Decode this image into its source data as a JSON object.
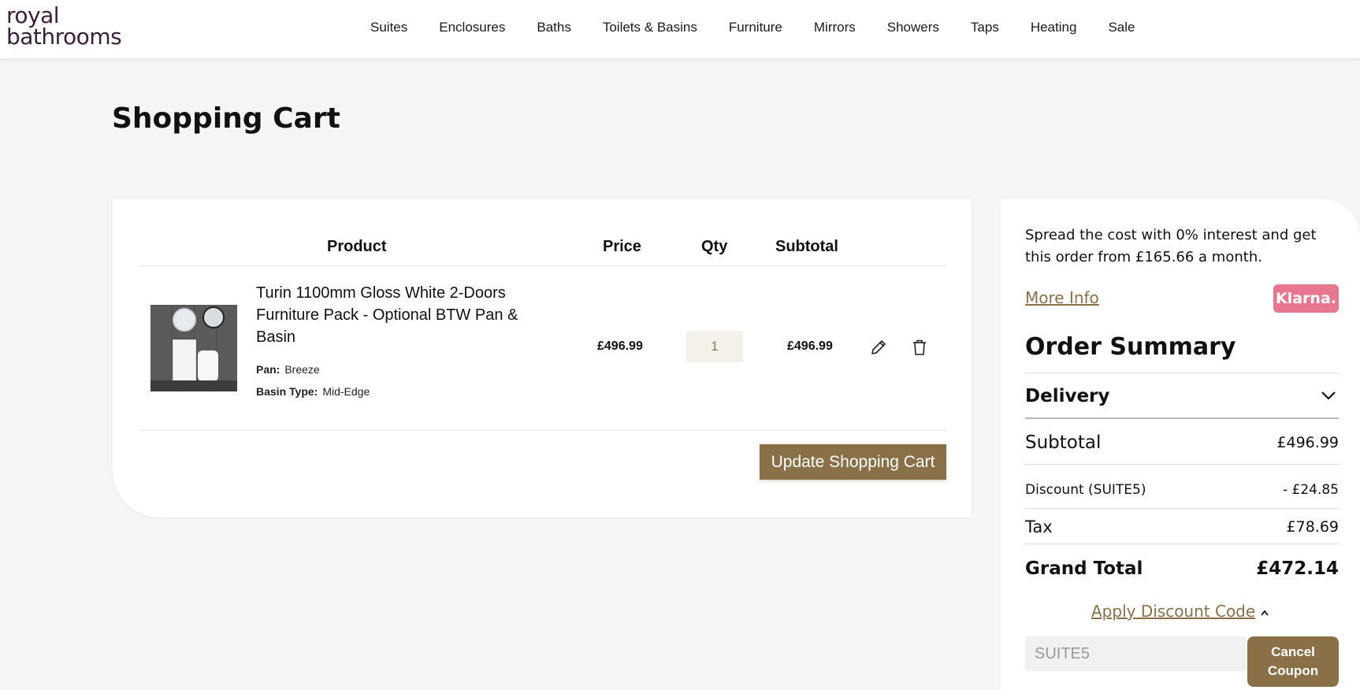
{
  "brand": {
    "line1": "royal",
    "line2": "bathrooms"
  },
  "nav": [
    "Suites",
    "Enclosures",
    "Baths",
    "Toilets & Basins",
    "Furniture",
    "Mirrors",
    "Showers",
    "Taps",
    "Heating",
    "Sale"
  ],
  "page_title": "Shopping Cart",
  "cart": {
    "columns": {
      "product": "Product",
      "price": "Price",
      "qty": "Qty",
      "subtotal": "Subtotal"
    },
    "item": {
      "name": "Turin 1100mm Gloss White 2-Doors Furniture Pack - Optional BTW Pan & Basin",
      "options": [
        {
          "label": "Pan:",
          "value": "Breeze"
        },
        {
          "label": "Basin Type:",
          "value": "Mid-Edge"
        }
      ],
      "price": "£496.99",
      "qty": "1",
      "subtotal": "£496.99",
      "edit_icon": "pencil-icon",
      "delete_icon": "trash-icon"
    },
    "update_button": "Update Shopping Cart"
  },
  "summary": {
    "klarna_text": "Spread the cost with 0% interest and get this order from £165.66 a month.",
    "more_info": "More Info",
    "klarna_badge": "Klarna.",
    "title": "Order Summary",
    "delivery": "Delivery",
    "subtotal_label": "Subtotal",
    "subtotal_value": "£496.99",
    "discount_label": "Discount (SUITE5)",
    "discount_value": "- £24.85",
    "tax_label": "Tax",
    "tax_value": "£78.69",
    "grand_total_label": "Grand Total",
    "grand_total_value": "£472.14",
    "apply_discount": "Apply Discount Code",
    "coupon_value": "SUITE5",
    "cancel_coupon": "Cancel Coupon"
  },
  "colors": {
    "accent": "#8a7047",
    "klarna": "#e9768f",
    "logo": "#3a1f3a"
  }
}
